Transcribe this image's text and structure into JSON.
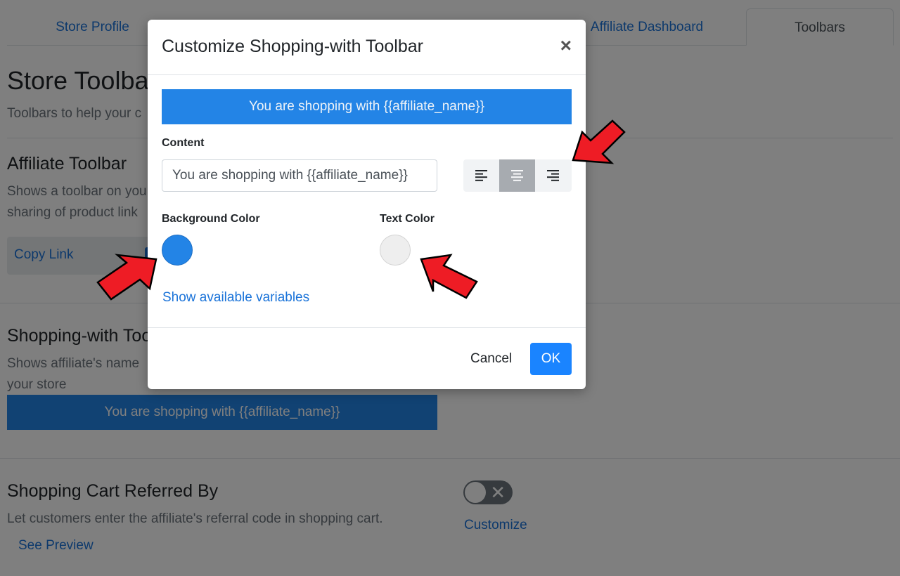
{
  "tabs": [
    {
      "label": "Store Profile"
    },
    {
      "label": "Affiliate Dashboard"
    },
    {
      "label": "Toolbars"
    }
  ],
  "page": {
    "title": "Store Toolbar",
    "subtitle": "Toolbars to help your c"
  },
  "affiliate_toolbar": {
    "title": "Affiliate Toolbar",
    "desc_line1": "Shows a toolbar on you",
    "desc_line2": "sharing of product link",
    "copy_link": "Copy Link"
  },
  "shopping_with": {
    "title": "Shopping-with Too",
    "desc_line1": "Shows affiliate's name",
    "desc_line2": "your store",
    "preview_text": "You are shopping with {{affiliate_name}}"
  },
  "cart_referred": {
    "title": "Shopping Cart Referred By",
    "desc": "Let customers enter the affiliate's referral code in shopping cart.",
    "see_preview": "See Preview",
    "customize": "Customize",
    "toggle_state": "off"
  },
  "modal": {
    "title": "Customize Shopping-with Toolbar",
    "close_symbol": "×",
    "preview_text": "You are shopping with {{affiliate_name}}",
    "content_label": "Content",
    "content_value": "You are shopping with {{affiliate_name}}",
    "alignment": {
      "options": [
        "align-left-icon",
        "align-center-icon",
        "align-right-icon"
      ],
      "selected": "center"
    },
    "background_color_label": "Background Color",
    "background_color": "#2384e6",
    "text_color_label": "Text Color",
    "text_color": "#eeeeee",
    "show_variables": "Show available variables",
    "cancel": "Cancel",
    "ok": "OK"
  },
  "colors": {
    "accent": "#1a84ff",
    "link": "#1a73d9",
    "arrow": "#ee1c25"
  }
}
